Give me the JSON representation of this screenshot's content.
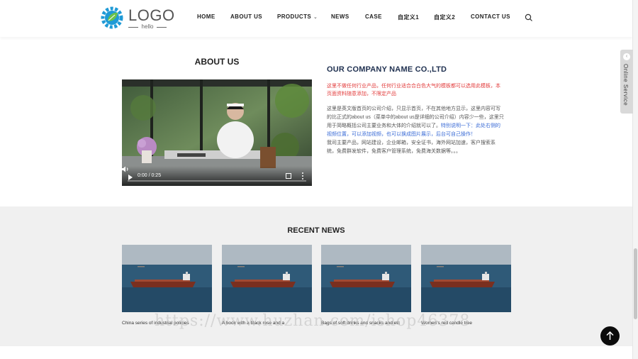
{
  "header": {
    "logo_text": "LOGO",
    "logo_sub": "hello",
    "nav": [
      "HOME",
      "ABOUT US",
      "PRODUCTS",
      "NEWS",
      "CASE",
      "自定义1",
      "自定义2",
      "CONTACT US"
    ]
  },
  "online_service": "Online Service",
  "about": {
    "title": "ABOUT US",
    "video_time": "0:00 / 0:25",
    "company_name": "OUR COMPANY NAME CO.,LTD",
    "red_note": "这里不做任何行业产品，任何行业适合合白色大气的模板都可以选用此模板，本页面资料随意添加，不限定产品",
    "body_part1": "这里是英文版首页的公司介绍，只显示首页，不在其他地方显示，这里内容可写的比正式的about us（菜单中的about us是详细的公司介绍）内容少一些，这里只用于简略概括公司主要业务和大体的介绍就可以了。",
    "body_part2": "特别说明一下：此处右侧的视频位置，可以添加视频，也可以换成图片展示，后台可自己操作！",
    "body_part3": "我司主要产品，网站建设，企业邮箱，安全证书，海外网站加速，客户搜索系统，免费群发软件，免费客户管理系统，免费海关数据等。。。"
  },
  "news": {
    "title": "RECENT NEWS",
    "items": [
      {
        "caption": "China series of industrial policies"
      },
      {
        "caption": "A book with a black rose and a"
      },
      {
        "caption": "Bags of soft drinks and snacks and etc"
      },
      {
        "caption": "Women's red candle tree"
      }
    ]
  },
  "watermark": "https://www.huzhan.com/ishop46378",
  "colors": {
    "accent_red": "#e23b3b",
    "accent_blue": "#3a6bd6",
    "title_navy": "#1f3050"
  }
}
